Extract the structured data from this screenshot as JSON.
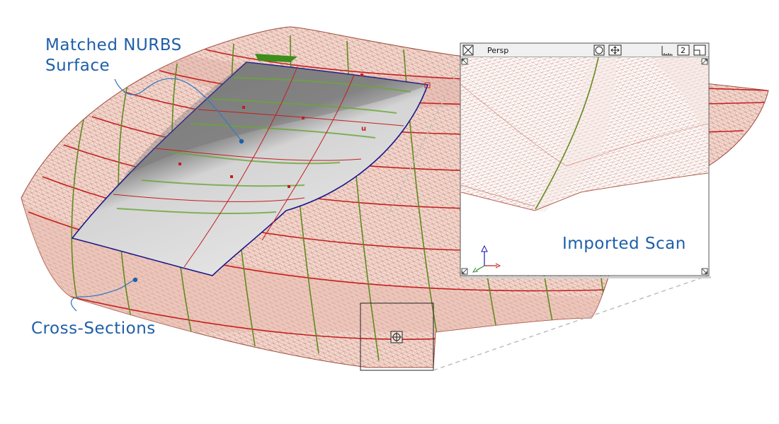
{
  "callouts": {
    "nurbs_line1": "Matched NURBS",
    "nurbs_line2": "Surface",
    "cross_sections": "Cross-Sections",
    "imported_scan": "Imported Scan"
  },
  "viewport": {
    "title": "Persp",
    "layout_number": "2"
  },
  "icons": {
    "viewport_close": "close-box-icon",
    "camera_orbit": "circle-icon",
    "camera_move": "four-way-arrows-icon",
    "window_layout": "ruler-icon",
    "window_maximize": "maximize-icon",
    "corner_resize": "resize-arrow-icon",
    "axis_triad": "xyz-axis-icon",
    "view_target": "target-icon"
  },
  "colors": {
    "mesh": "#b05a4a",
    "mesh_fill": "#ecc9bf",
    "cross_section": "#c41e1e",
    "cross_section_green": "#5f8a1e",
    "nurbs_edge": "#1a1a8c",
    "callout_text": "#1f5fa8"
  }
}
